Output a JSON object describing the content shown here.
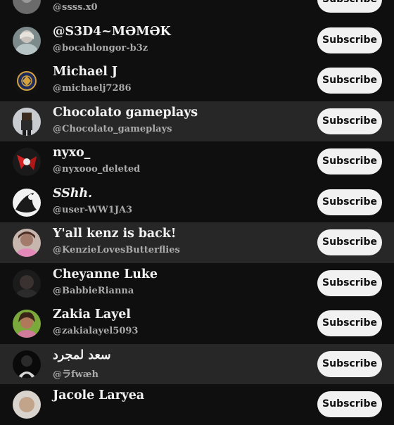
{
  "subscribe_label": "Subscribe",
  "channels": [
    {
      "name": "",
      "handle": "@ssss.x0"
    },
    {
      "name": "@S3D4~MƏMƏK",
      "handle": "@bocahlongor-b3z"
    },
    {
      "name": "Michael J",
      "handle": "@michaelj7286"
    },
    {
      "name": "Chocolato gameplays",
      "handle": "@Chocolato_gameplays"
    },
    {
      "name": "nyxo_",
      "handle": "@nyxooo_deleted"
    },
    {
      "name": "SShh.",
      "handle": "@user-WW1JA3"
    },
    {
      "name": "Y'all kenz is back!",
      "handle": "@KenzieLovesButterflies"
    },
    {
      "name": "Cheyanne Luke",
      "handle": "@BabbieRianna"
    },
    {
      "name": "Zakia Layel",
      "handle": "@zakialayel5093"
    },
    {
      "name": "سعد لمجرد",
      "handle": "@ラfwæh"
    },
    {
      "name": "Jacole Laryea",
      "handle": ""
    }
  ],
  "colors": {
    "background": "#0f0f0f",
    "highlight_row": "#272727",
    "button_bg": "#f1f1f1",
    "button_text": "#0f0f0f",
    "name_text": "#f1f1f1",
    "handle_text": "#aaaaaa"
  }
}
